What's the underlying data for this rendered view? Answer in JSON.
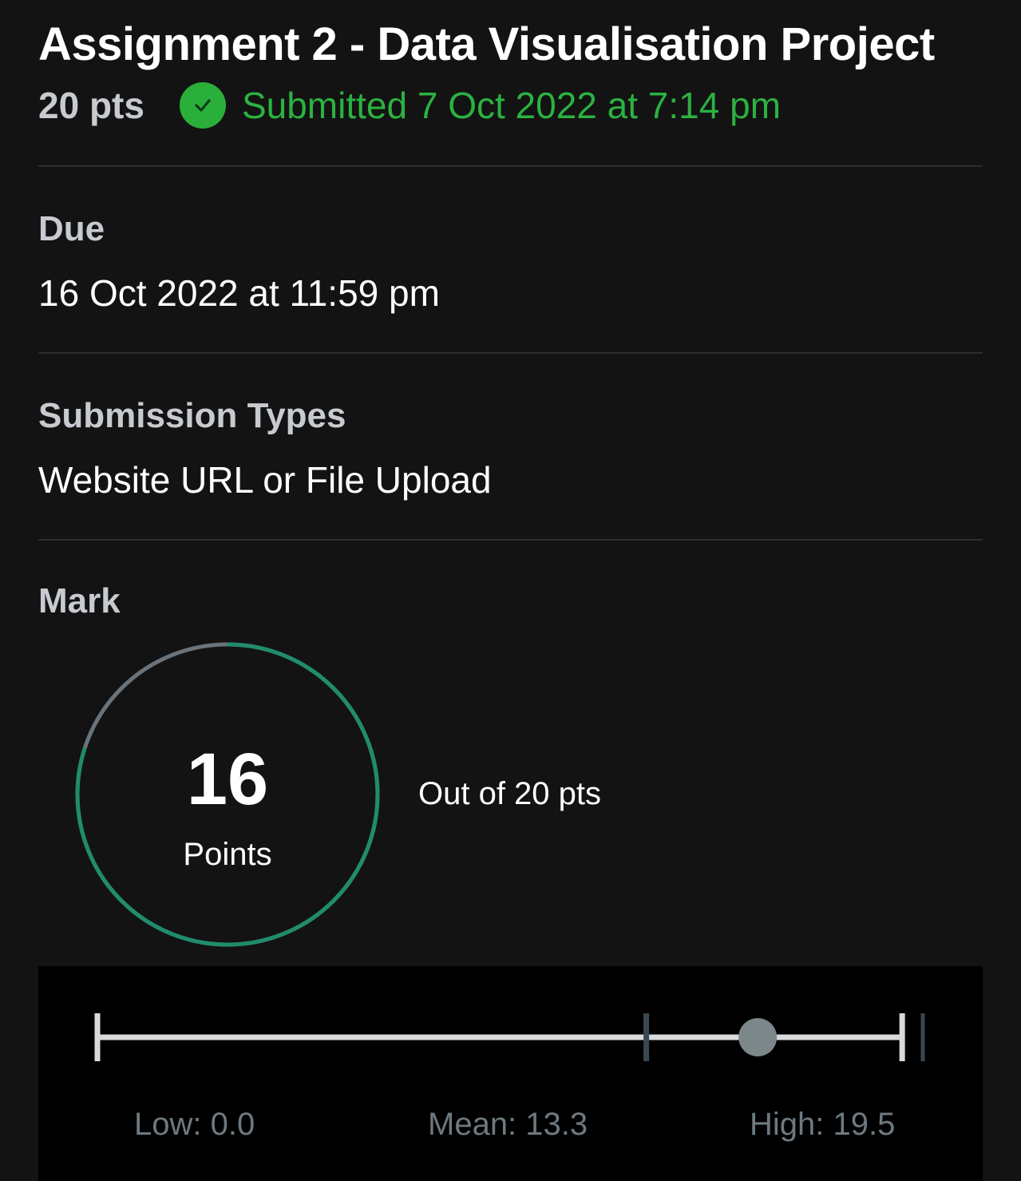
{
  "assignment": {
    "title": "Assignment 2 - Data Visualisation Project",
    "points": "20 pts",
    "status_icon": "check-circle-icon",
    "status_text": "Submitted 7 Oct 2022 at 7:14 pm",
    "status_color": "#2ab03a"
  },
  "due": {
    "label": "Due",
    "value": "16 Oct 2022 at 11:59 pm"
  },
  "submission_types": {
    "label": "Submission Types",
    "value": "Website URL or File Upload"
  },
  "mark": {
    "label": "Mark",
    "score": "16",
    "score_unit": "Points",
    "out_of": "Out of 20 pts",
    "score_value": 16,
    "max_value": 20,
    "ring_color": "#1f8c6c",
    "ring_track_color": "#6b737a"
  },
  "stats": {
    "low_label": "Low: 0.0",
    "mean_label": "Mean: 13.3",
    "high_label": "High: 19.5",
    "low": 0.0,
    "mean": 13.3,
    "high": 19.5,
    "score": 16,
    "max": 20
  }
}
